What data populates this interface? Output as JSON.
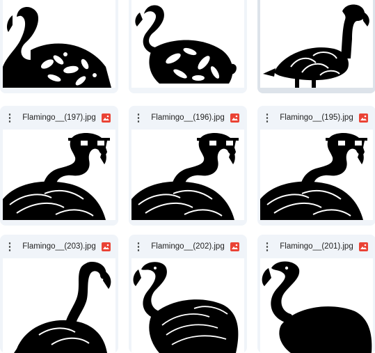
{
  "grid": {
    "rows": [
      {
        "cards": [
          {
            "name": "",
            "art": "floral-flamingo-head"
          },
          {
            "name": "",
            "art": "floral-flamingo-full"
          },
          {
            "name": "",
            "art": "swirl-flamingo",
            "selected": true
          }
        ]
      },
      {
        "cards": [
          {
            "name": "Flamingo__(197).jpg",
            "art": "sunglasses-flamingo"
          },
          {
            "name": "Flamingo__(196).jpg",
            "art": "sunglasses-flamingo"
          },
          {
            "name": "Flamingo__(195).jpg",
            "art": "sunglasses-flamingo"
          }
        ]
      },
      {
        "cards": [
          {
            "name": "Flamingo__(203).jpg",
            "art": "silhouette-flamingo"
          },
          {
            "name": "Flamingo__(202).jpg",
            "art": "feathered-flamingo"
          },
          {
            "name": "Flamingo__(201).jpg",
            "art": "dark-flamingo"
          }
        ]
      }
    ]
  },
  "icons": {
    "more": "more-vert-icon",
    "file": "image-file-icon"
  },
  "colors": {
    "card_bg": "#f0f4f9",
    "selected_bg": "#dde3ea",
    "file_icon": "#ea4335",
    "ink": "#000000"
  }
}
